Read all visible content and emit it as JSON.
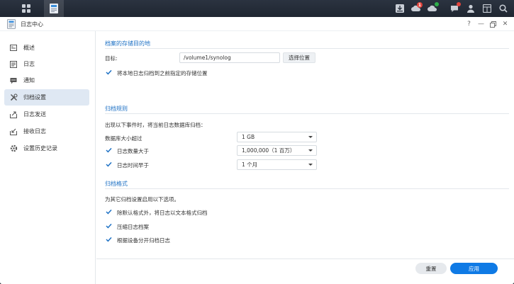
{
  "window": {
    "title": "日志中心"
  },
  "sidebar": {
    "items": [
      {
        "label": "概述",
        "icon": "overview-icon"
      },
      {
        "label": "日志",
        "icon": "log-icon"
      },
      {
        "label": "通知",
        "icon": "notification-icon"
      },
      {
        "label": "归档设置",
        "icon": "tools-icon",
        "active": true
      },
      {
        "label": "日志发送",
        "icon": "send-icon"
      },
      {
        "label": "接收日志",
        "icon": "receive-icon"
      },
      {
        "label": "设置历史记录",
        "icon": "gear-icon"
      }
    ]
  },
  "archive_destination": {
    "title": "档案的存储目的地",
    "target_label": "目标:",
    "target_value": "/volume1/synolog",
    "choose_button": "选择位置",
    "move_checkbox": {
      "label": "将本地日志归档到之前指定的存储位置",
      "checked": true
    }
  },
  "archive_rules": {
    "title": "归档规则",
    "description": "出现以下事件时，将当前日志数据库归档：",
    "db_size": {
      "label": "数据库大小超过",
      "value": "1 GB"
    },
    "log_count": {
      "label": "日志数量大于",
      "value": "1,000,000（1 百万）",
      "checked": true
    },
    "log_time": {
      "label": "日志时间早于",
      "value": "1 个月",
      "checked": true
    }
  },
  "archive_format": {
    "title": "归档格式",
    "description": "为其它归档设置启用以下选项。",
    "options": [
      {
        "label": "除默认格式外，将日志以文本格式归档",
        "checked": true
      },
      {
        "label": "压缩日志档案",
        "checked": true
      },
      {
        "label": "根据设备分开归档日志",
        "checked": true
      }
    ]
  },
  "footer": {
    "reset_label": "重置",
    "apply_label": "应用"
  },
  "taskbar": {
    "badge_red": "1",
    "badge_green": "",
    "badge_red2": ""
  },
  "colors": {
    "accent": "#1f72c5",
    "apply": "#0f7ae5",
    "check": "#1f72c5"
  }
}
